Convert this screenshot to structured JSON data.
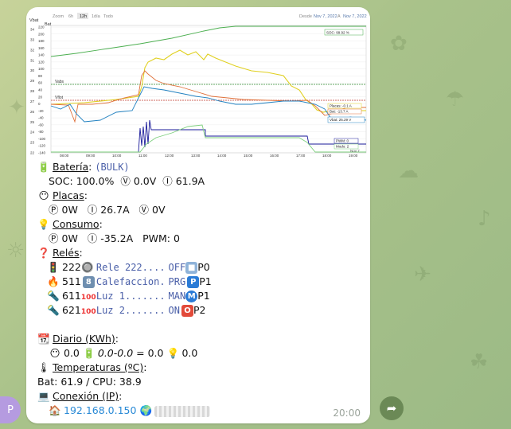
{
  "avatar": {
    "letter": "P"
  },
  "chart": {
    "topbar": {
      "zoom_label": "Zoom",
      "options": [
        "6h",
        "12h",
        "1día",
        "Todo"
      ],
      "selected": "12h",
      "range_from_label": "Desde",
      "range_from": "Nov 7, 2022",
      "range_to_label": "A",
      "range_to": "Nov 7, 2022"
    },
    "axis_left_top": "Vbat",
    "axis_left_top2": "Bat",
    "y_left_ticks": [
      "34",
      "33",
      "32",
      "31",
      "30",
      "29",
      "28",
      "27",
      "26",
      "25",
      "24",
      "23",
      "22"
    ],
    "y_right_ticks": [
      "220",
      "200",
      "180",
      "160",
      "140",
      "120",
      "100",
      "80",
      "60",
      "40",
      "20",
      "0",
      "-20",
      "-40",
      "-60",
      "-80",
      "-100",
      "-120",
      "-140"
    ],
    "x_ticks": [
      "08:00",
      "09:00",
      "10:00",
      "11:00",
      "12:00",
      "13:00",
      "14:00",
      "15:00",
      "16:00",
      "17:00",
      "18:00",
      "19:00"
    ],
    "labels": {
      "vabs": "Vabs",
      "vflot": "Vflot"
    },
    "legend": {
      "soc": "SOC: 99.92 %",
      "placas": "Placas: -0.1 A",
      "bat": "Bat: -13.7 A",
      "vbat": "Vbat: 25.29 V",
      "pwm": "PWM: 0",
      "modo": "Modo: 2",
      "date": "Nov 7"
    }
  },
  "message": {
    "bateria": {
      "title": "Batería",
      "colon": ":",
      "mode": "(BULK)",
      "soc_label": "SOC:",
      "soc_value": "100.0%",
      "v_icon": "Ⓥ",
      "v_value": "0.0V",
      "i_icon": "Ⓘ",
      "i_value": "61.9A"
    },
    "placas": {
      "title": "Placas",
      "colon": ":",
      "p_icon": "Ⓟ",
      "p_value": "0W",
      "i_icon": "Ⓘ",
      "i_value": "26.7A",
      "v_icon": "Ⓥ",
      "v_value": "0V"
    },
    "consumo": {
      "title": "Consumo",
      "colon": ":",
      "p_icon": "Ⓟ",
      "p_value": "0W",
      "i_icon": "Ⓘ",
      "i_value": "-35.2A",
      "pwm_label": "PWM:",
      "pwm_value": "0"
    },
    "reles": {
      "title": "Relés",
      "colon": ":",
      "rows": [
        {
          "id": "222",
          "name": "Rele 222....",
          "state": "OFF",
          "pri": "P0",
          "badge": "",
          "pri_color": "#8fb3d9"
        },
        {
          "id": "511",
          "name": "Calefaccion.",
          "state": "PRG",
          "pri": "P1",
          "badge": "8",
          "pri_color": "#2a7bd6"
        },
        {
          "id": "611",
          "name": "Luz 1.......",
          "state": "MAN",
          "pri": "P1",
          "badge": "100",
          "pri_color": "#2a7bd6"
        },
        {
          "id": "621",
          "name": "Luz 2.......",
          "state": "ON",
          "pri": "P2",
          "badge": "100",
          "pri_color": "#2a7bd6"
        }
      ]
    },
    "diario": {
      "title": "Diario (KWh)",
      "colon": ":",
      "placas": "0.0",
      "bat": "0.0-0.0",
      "eq": "= 0.0",
      "consumo": "0.0"
    },
    "temperaturas": {
      "title": "Temperaturas (ºC)",
      "colon": ":",
      "text": "Bat: 61.9 / CPU: 38.9"
    },
    "conexion": {
      "title": "Conexión (IP)",
      "colon": ":",
      "ip": "192.168.0.150"
    },
    "time": "20:00"
  },
  "colors": {
    "soc": "#4caf50",
    "solar_yellow": "#e0d020",
    "bat_orange": "#e0703a",
    "vbat_blue": "#2080c0",
    "pwm_navy": "#1a1a9a",
    "vabs": "#2e8b2e",
    "vflot": "#c0392b"
  }
}
